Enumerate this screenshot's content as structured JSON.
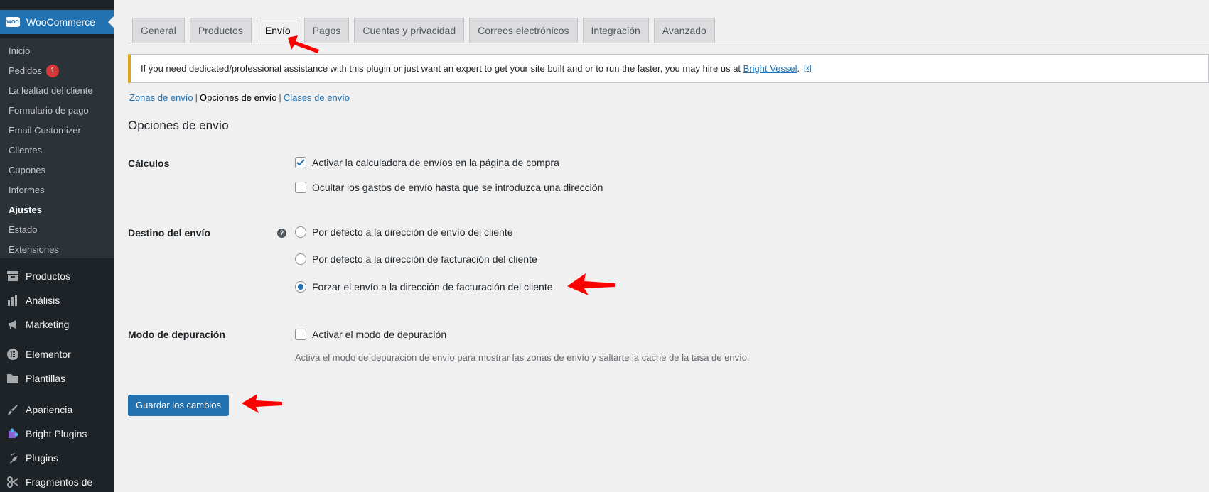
{
  "sidebar": {
    "plugin_logo": "WOO",
    "plugin_title": "WooCommerce",
    "submenu": [
      {
        "label": "Inicio"
      },
      {
        "label": "Pedidos",
        "badge": "1"
      },
      {
        "label": "La lealtad del cliente"
      },
      {
        "label": "Formulario de pago"
      },
      {
        "label": "Email Customizer"
      },
      {
        "label": "Clientes"
      },
      {
        "label": "Cupones"
      },
      {
        "label": "Informes"
      },
      {
        "label": "Ajustes",
        "active": true
      },
      {
        "label": "Estado"
      },
      {
        "label": "Extensiones"
      }
    ],
    "menu": [
      {
        "label": "Productos",
        "icon": "archive-icon"
      },
      {
        "label": "Análisis",
        "icon": "bar-chart-icon"
      },
      {
        "label": "Marketing",
        "icon": "megaphone-icon"
      },
      {
        "label": "Elementor",
        "icon": "elementor-icon"
      },
      {
        "label": "Plantillas",
        "icon": "folder-icon"
      },
      {
        "label": "Apariencia",
        "icon": "paintbrush-icon"
      },
      {
        "label": "Bright Plugins",
        "icon": "puzzle-icon"
      },
      {
        "label": "Plugins",
        "icon": "plug-icon"
      },
      {
        "label": "Fragmentos de",
        "icon": "scissors-icon"
      }
    ]
  },
  "tabs": [
    {
      "label": "General"
    },
    {
      "label": "Productos"
    },
    {
      "label": "Envío",
      "active": true
    },
    {
      "label": "Pagos"
    },
    {
      "label": "Cuentas y privacidad"
    },
    {
      "label": "Correos electrónicos"
    },
    {
      "label": "Integración"
    },
    {
      "label": "Avanzado"
    }
  ],
  "notice": {
    "text": "If you need dedicated/professional assistance with this plugin or just want an expert to get your site built and or to run the faster, you may hire us at ",
    "link": "Bright Vessel",
    "after": ".",
    "dismiss": "[x]"
  },
  "subnav": {
    "zones": "Zonas de envío",
    "options": "Opciones de envío",
    "classes": "Clases de envío",
    "sep": "|"
  },
  "section_title": "Opciones de envío",
  "calculations": {
    "label": "Cálculos",
    "options": [
      {
        "label": "Activar la calculadora de envíos en la página de compra",
        "checked": true
      },
      {
        "label": "Ocultar los gastos de envío hasta que se introduzca una dirección",
        "checked": false
      }
    ]
  },
  "destination": {
    "label": "Destino del envío",
    "help": "?",
    "options": [
      {
        "label": "Por defecto a la dirección de envío del cliente",
        "checked": false
      },
      {
        "label": "Por defecto a la dirección de facturación del cliente",
        "checked": false
      },
      {
        "label": "Forzar el envío a la dirección de facturación del cliente",
        "checked": true
      }
    ]
  },
  "debug": {
    "label": "Modo de depuración",
    "option": "Activar el modo de depuración",
    "checked": false,
    "description": "Activa el modo de depuración de envío para mostrar las zonas de envío y saltarte la cache de la tasa de envío."
  },
  "save_button": "Guardar los cambios",
  "colors": {
    "accent": "#2271b1",
    "sidebar_bg": "#1d2327",
    "annotation_arrow": "#ff0000"
  }
}
